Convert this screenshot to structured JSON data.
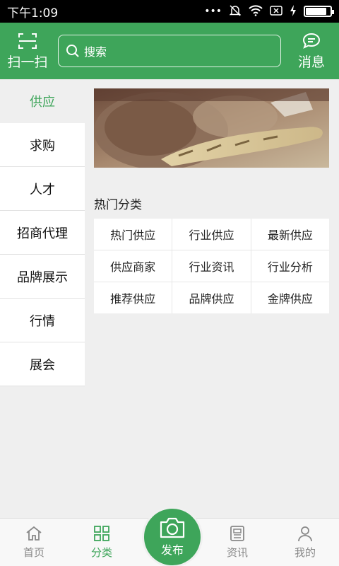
{
  "status_bar": {
    "time": "下午1:09",
    "battery_percent": 85
  },
  "header": {
    "scan_label": "扫一扫",
    "search_placeholder": "搜索",
    "message_label": "消息"
  },
  "sidebar": {
    "items": [
      {
        "label": "供应",
        "active": true
      },
      {
        "label": "求购",
        "active": false
      },
      {
        "label": "人才",
        "active": false
      },
      {
        "label": "招商代理",
        "active": false
      },
      {
        "label": "品牌展示",
        "active": false
      },
      {
        "label": "行情",
        "active": false
      },
      {
        "label": "展会",
        "active": false
      }
    ]
  },
  "main": {
    "section_title": "热门分类",
    "categories": [
      "热门供应",
      "行业供应",
      "最新供应",
      "供应商家",
      "行业资讯",
      "行业分析",
      "推荐供应",
      "品牌供应",
      "金牌供应"
    ]
  },
  "tabbar": {
    "home": "首页",
    "category": "分类",
    "publish": "发布",
    "news": "资讯",
    "mine": "我的"
  },
  "colors": {
    "brand_green": "#3ea55a"
  }
}
